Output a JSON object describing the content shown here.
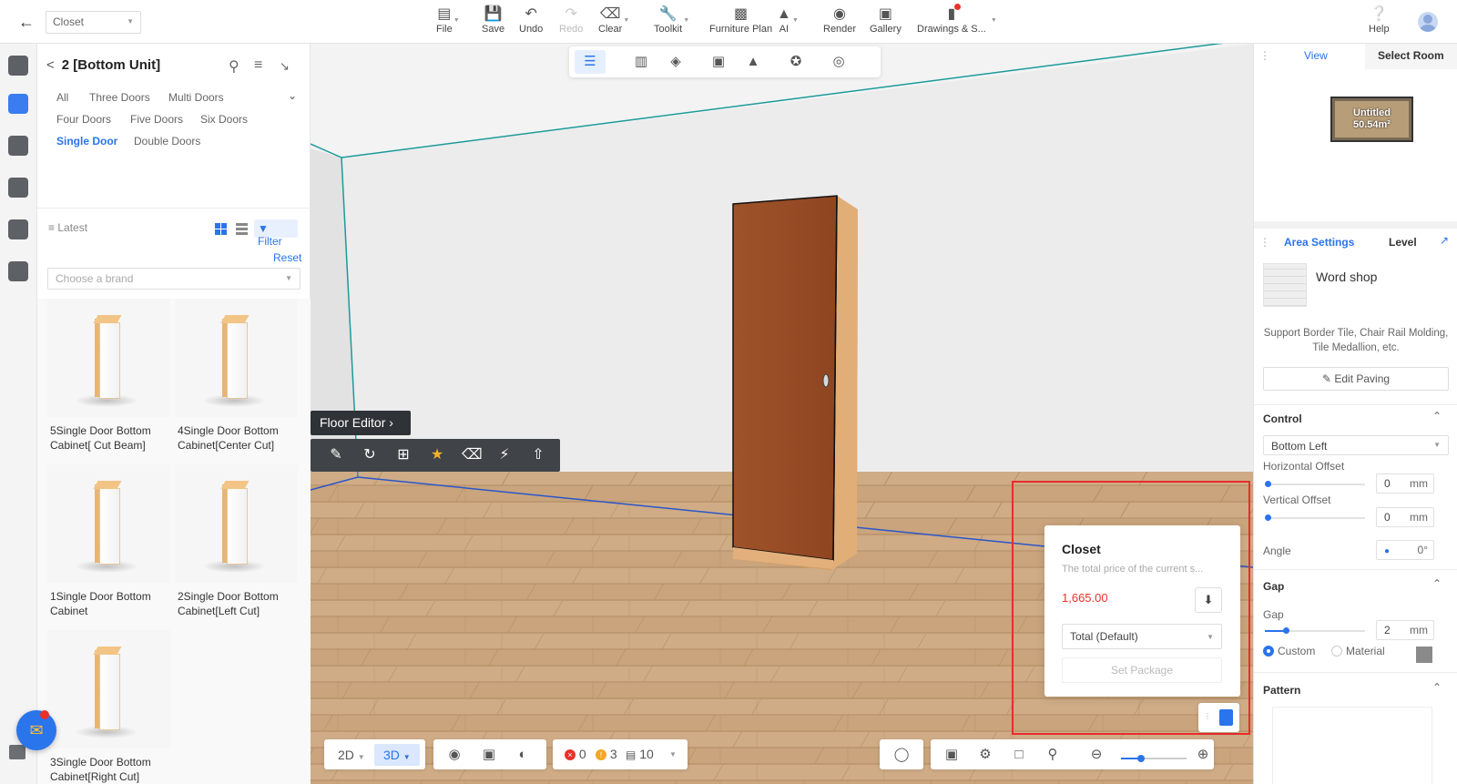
{
  "topbar": {
    "project_name": "Closet",
    "items": [
      {
        "label": "File",
        "icon": "file-icon"
      },
      {
        "label": "Save",
        "icon": "save-icon"
      },
      {
        "label": "Undo",
        "icon": "undo-icon"
      },
      {
        "label": "Redo",
        "icon": "redo-icon"
      },
      {
        "label": "Clear",
        "icon": "eraser-icon"
      },
      {
        "label": "Toolkit",
        "icon": "wrench-icon"
      },
      {
        "label": "Furniture Plan",
        "icon": "furniture-plan-icon"
      },
      {
        "label": "AI",
        "icon": "ai-icon"
      },
      {
        "label": "Render",
        "icon": "camera-icon"
      },
      {
        "label": "Gallery",
        "icon": "gallery-icon"
      },
      {
        "label": "Drawings & S...",
        "icon": "drawings-icon"
      },
      {
        "label": "Help",
        "icon": "help-icon"
      }
    ]
  },
  "catalog": {
    "title": "2 [Bottom Unit]",
    "tags": [
      "All",
      "Three Doors",
      "Multi Doors",
      "Four Doors",
      "Five Doors",
      "Six Doors",
      "Single Door",
      "Double Doors"
    ],
    "active_tag": "Single Door",
    "sort_label": "Latest",
    "filter_label": "Filter",
    "reset_label": "Reset",
    "brand_placeholder": "Choose a brand",
    "products": [
      {
        "name": "5Single Door Bottom Cabinet[ Cut Beam]"
      },
      {
        "name": "4Single Door Bottom Cabinet[Center Cut]"
      },
      {
        "name": "1Single Door Bottom Cabinet"
      },
      {
        "name": "2Single Door Bottom Cabinet[Left Cut]"
      },
      {
        "name": "3Single Door Bottom Cabinet[Right Cut]"
      }
    ]
  },
  "viewport": {
    "floor_editor_label": "Floor Editor",
    "price_card": {
      "title": "Closet",
      "description": "The total price of the current s...",
      "price": "1,665.00",
      "select_value": "Total (Default)",
      "set_package_label": "Set Package"
    },
    "view_modes": {
      "mode_2d": "2D",
      "mode_3d": "3D"
    },
    "stats": {
      "errors": "0",
      "warnings": "3",
      "items": "10"
    },
    "zoom_level": 0.3
  },
  "right_panel": {
    "tabs": [
      "View",
      "Select Room"
    ],
    "minimap_label": "Untitled",
    "minimap_area": "50.54m²",
    "settings_tabs": [
      "Area Settings",
      "Level"
    ],
    "material_name": "Word shop",
    "material_desc": "Support Border Tile, Chair Rail Molding, Tile Medallion, etc.",
    "edit_paving_label": "Edit Paving",
    "control": {
      "heading": "Control",
      "anchor": "Bottom Left",
      "horizontal_offset_label": "Horizontal Offset",
      "horizontal_offset": "0",
      "vertical_offset_label": "Vertical Offset",
      "vertical_offset": "0",
      "angle_label": "Angle",
      "angle": "0°",
      "unit": "mm"
    },
    "gap": {
      "heading": "Gap",
      "label": "Gap",
      "value": "2",
      "unit": "mm",
      "options": [
        "Custom",
        "Material"
      ],
      "selected": "Custom"
    },
    "pattern_heading": "Pattern"
  },
  "colors": {
    "accent": "#2a74ec",
    "price_red": "#e8332a",
    "highlight_red": "#e82d2d",
    "door_wood": "#9b4d24"
  }
}
